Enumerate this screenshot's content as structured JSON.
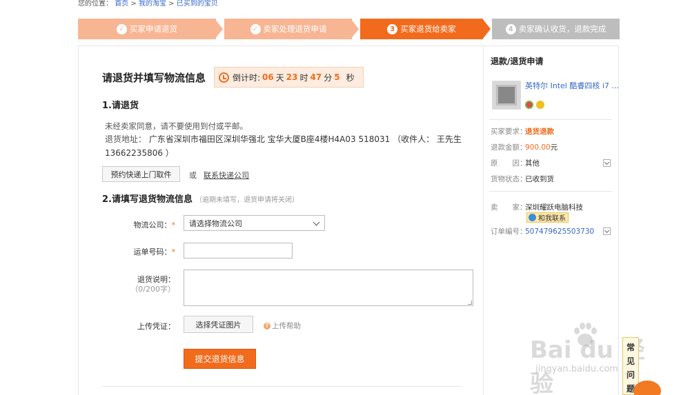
{
  "breadcrumb": {
    "prefix": "您的位置：",
    "home": "首页",
    "sep1": ">",
    "taobao": "我的淘宝",
    "sep2": ">",
    "bought": "已买到的宝贝"
  },
  "steps": [
    {
      "label": "买家申请退货",
      "mark": "✓",
      "state": "done"
    },
    {
      "label": "卖家处理退货申请",
      "mark": "✓",
      "state": "done"
    },
    {
      "label": "买家退货给卖家",
      "mark": "3",
      "state": "current"
    },
    {
      "label": "卖家确认收货，退款完成",
      "mark": "4",
      "state": "todo"
    }
  ],
  "main": {
    "title": "请退货并填写物流信息",
    "countdown": {
      "label": "倒计时:",
      "days": "06",
      "days_unit": "天",
      "hours": "23",
      "hours_unit": "时",
      "minutes": "47",
      "minutes_unit": "分",
      "seconds": "5",
      "seconds_unit": "秒"
    },
    "section1": {
      "title": "1.请退货",
      "notice": "未经卖家同意，请不要使用到付或平邮。",
      "address_label": "退货地址：",
      "address": "广东省深圳市福田区深圳华强北 宝华大厦B座4楼H4A03 518031 （收件人： 王先生 13662235806 ）",
      "pickup_button": "预约快递上门取件",
      "or": "或",
      "contact_link": "联系快递公司"
    },
    "section2": {
      "title": "2.请填写退货物流信息",
      "hint": "（逾期未填写，退货申请将关闭）",
      "company_label": "物流公司：",
      "company_value": "请选择物流公司",
      "tracking_label": "运单号码：",
      "note_label": "退货说明：",
      "note_limit": "（0/200字）",
      "upload_label": "上传凭证：",
      "upload_button": "选择凭证图片",
      "upload_help": "上传帮助",
      "required_mark": "*",
      "submit": "提交退货信息"
    }
  },
  "side": {
    "title": "退款/退货申请",
    "product": "英特尔 Intel 酷睿四核 i7 ...",
    "rows1": [
      {
        "k": "买家要求：",
        "v": "退货退款"
      },
      {
        "k": "退款金额：",
        "v": "900.00",
        "unit": "元"
      },
      {
        "k": "原　　因：",
        "v": "其他"
      },
      {
        "k": "货物状态：",
        "v": "已收到货"
      }
    ],
    "seller_label": "卖　　家：",
    "seller": "深圳耀跃电脑科技",
    "talk": "和我联系",
    "order_label": "订单编号：",
    "order": "507479625503730"
  },
  "watermark": {
    "brand": "Bai du 经验",
    "url": "jingyan.baidu.com"
  },
  "faq": "常见问题",
  "colors": {
    "accent": "#f26b1d",
    "done": "#f8b593",
    "todo": "#bdbdbd",
    "link": "#3366cc"
  }
}
